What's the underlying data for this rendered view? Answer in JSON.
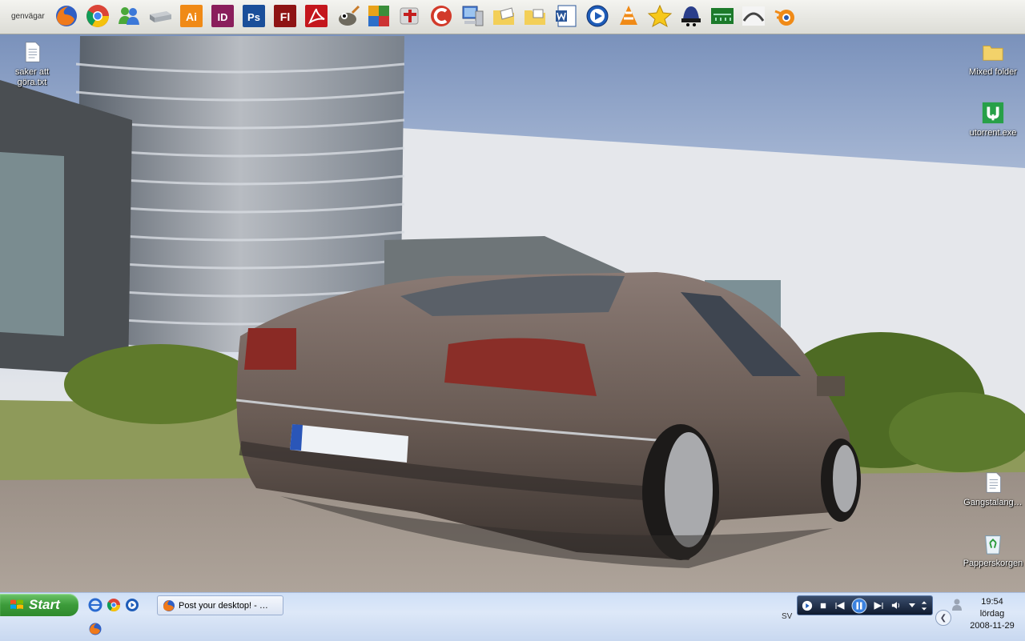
{
  "toolbar": {
    "label": "genvägar",
    "icons": [
      "firefox-icon",
      "chrome-icon",
      "messenger-icon",
      "drive-icon",
      "illustrator-icon",
      "indesign-icon",
      "photoshop-icon",
      "flash-icon",
      "acrobat-icon",
      "gimp-icon",
      "winamp-icon",
      "hammer-icon",
      "ccleaner-icon",
      "my-computer-icon",
      "folder-mail-icon",
      "folder-icon",
      "word-icon",
      "media-player-icon",
      "vlc-icon",
      "star-icon",
      "hat-icon",
      "network-icon",
      "arch-icon",
      "blender-icon"
    ],
    "ai_text": "Ai",
    "id_text": "ID",
    "ps_text": "Ps",
    "fl_text": "Fl"
  },
  "desktop": {
    "icons": [
      {
        "label": "saker att göra.txt"
      },
      {
        "label": "Mixed folder"
      },
      {
        "label": "utorrent.exe"
      },
      {
        "label": "Gangstalang…"
      },
      {
        "label": "Papperskorgen"
      }
    ]
  },
  "taskbar": {
    "start_label": "Start",
    "window_title": "Post your desktop! - …",
    "lang": "SV",
    "time": "19:54",
    "day": "lördag",
    "date": "2008-11-29"
  },
  "colors": {
    "taskbar": "#dde8f8",
    "start": "#3c9b3a",
    "sky": "#dfe3ea"
  }
}
